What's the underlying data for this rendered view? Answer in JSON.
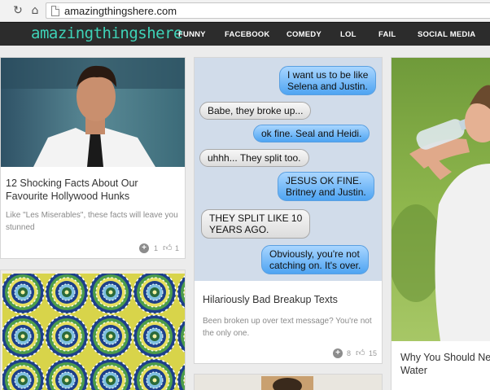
{
  "browser": {
    "url": "amazingthingshere.com"
  },
  "site": {
    "logo": "amazingthingshere",
    "menu": [
      "FUNNY",
      "FACEBOOK",
      "COMEDY",
      "LOL",
      "FAIL",
      "SOCIAL MEDIA"
    ]
  },
  "cards": {
    "hunks": {
      "title": "12 Shocking Facts About Our Favourite Hollywood Hunks",
      "description": "Like \"Les Miserables\", these facts will leave you stunned",
      "adds": "1",
      "likes": "1"
    },
    "breakup": {
      "title": "Hilariously Bad Breakup Texts",
      "description": "Been broken up over text message? You're not the only one.",
      "adds": "8",
      "likes": "15",
      "messages": [
        {
          "from": "me",
          "text": "I want us to be like\nSelena and Justin."
        },
        {
          "from": "them",
          "text": "Babe, they broke up..."
        },
        {
          "from": "me",
          "text": "ok fine. Seal and Heidi."
        },
        {
          "from": "them",
          "text": "uhhh... They split too."
        },
        {
          "from": "me",
          "text": "JESUS OK FINE.\nBritney and Justin."
        },
        {
          "from": "them",
          "text": "THEY SPLIT LIKE 10\nYEARS AGO."
        },
        {
          "from": "me",
          "text": "Obviously, you're not\ncatching on. It's over."
        }
      ]
    },
    "water": {
      "title": "Why You Should Ne Water"
    }
  }
}
